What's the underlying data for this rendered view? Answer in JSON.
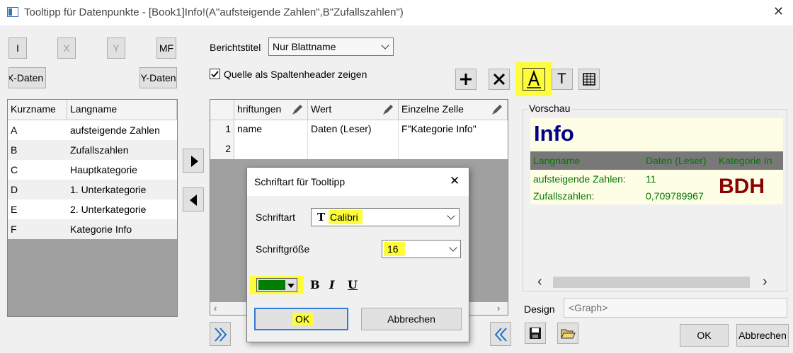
{
  "window": {
    "title": "Tooltipp für Datenpunkte - [Book1]Info!(A\"aufsteigende Zahlen\",B\"Zufallszahlen\")"
  },
  "left_buttons": {
    "i": "I",
    "x": "X",
    "y": "Y",
    "mf": "MF",
    "x_daten": "X-Daten",
    "y_daten": "Y-Daten"
  },
  "list": {
    "headers": [
      "Kurzname",
      "Langname"
    ],
    "rows": [
      {
        "short": "A",
        "long": "aufsteigende Zahlen"
      },
      {
        "short": "B",
        "long": "Zufallszahlen"
      },
      {
        "short": "C",
        "long": "Hauptkategorie"
      },
      {
        "short": "D",
        "long": "1. Unterkategorie"
      },
      {
        "short": "E",
        "long": "2. Unterkategorie"
      },
      {
        "short": "F",
        "long": "Kategorie Info"
      }
    ]
  },
  "report": {
    "label": "Berichtstitel",
    "value": "Nur Blattname",
    "checkbox_label": "Quelle als Spaltenheader zeigen",
    "checked": true
  },
  "table": {
    "headers": [
      "hriftungen",
      "Wert",
      "Einzelne Zelle"
    ],
    "rows": [
      {
        "num": "1",
        "c1": "name",
        "c2": "Daten (Leser)",
        "c3": "F\"Kategorie Info\""
      },
      {
        "num": "2",
        "c1": "",
        "c2": "",
        "c3": ""
      }
    ]
  },
  "preview": {
    "label": "Vorschau",
    "title": "Info",
    "headers": [
      "Langname",
      "Daten (Leser)",
      "Kategorie In"
    ],
    "rows": [
      {
        "name": "aufsteigende Zahlen:",
        "value": "11"
      },
      {
        "name": "Zufallszahlen:",
        "value": "0,709789967"
      }
    ],
    "category": "BDH",
    "colors": {
      "title": "#00008b",
      "text": "#007800",
      "category": "#8b0000",
      "header_bg": "#787878",
      "bg": "#fefde5"
    }
  },
  "design": {
    "label": "Design",
    "value": "<Graph>"
  },
  "footer": {
    "ok": "OK",
    "cancel": "Abbrechen"
  },
  "font_dialog": {
    "title": "Schriftart für Tooltipp",
    "font_label": "Schriftart",
    "font_value": "Calibri",
    "size_label": "Schriftgröße",
    "size_value": "16",
    "color": "#008000",
    "bold": "B",
    "italic": "I",
    "underline": "U",
    "ok": "OK",
    "cancel": "Abbrechen"
  },
  "toolbar_icons": {
    "text_icon": "T"
  },
  "highlight_color": "#fdfd3b"
}
